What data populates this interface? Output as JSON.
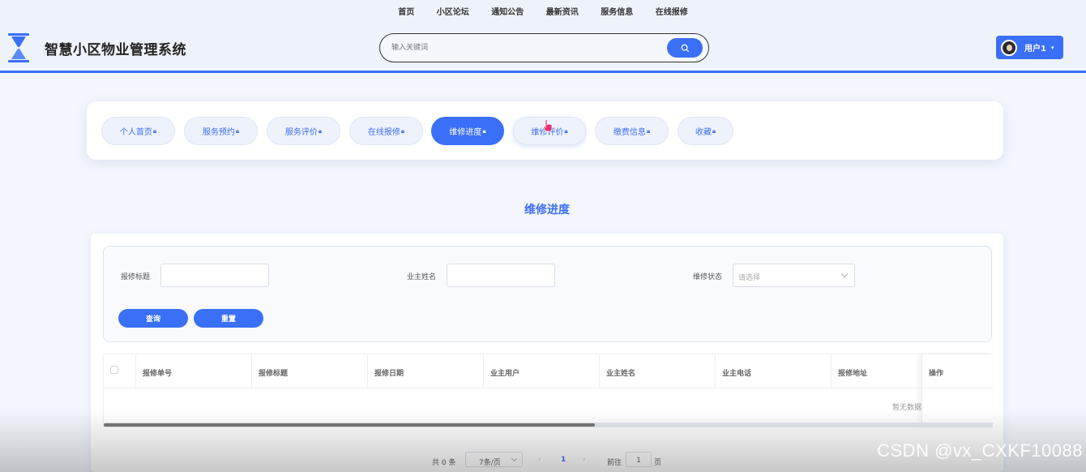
{
  "topnav": [
    "首页",
    "小区论坛",
    "通知公告",
    "最新资讯",
    "服务信息",
    "在线报修"
  ],
  "site_title": "智慧小区物业管理系统",
  "search": {
    "placeholder": "输入关键词",
    "icon": "search-icon"
  },
  "user": {
    "name": "用户1",
    "caret": "▾"
  },
  "tabs": [
    {
      "label": "个人首页",
      "active": false
    },
    {
      "label": "服务预约",
      "active": false
    },
    {
      "label": "服务评价",
      "active": false
    },
    {
      "label": "在线报修",
      "active": false
    },
    {
      "label": "维修进度",
      "active": true
    },
    {
      "label": "维修评价",
      "active": false
    },
    {
      "label": "缴费信息",
      "active": false
    },
    {
      "label": "收藏",
      "active": false
    }
  ],
  "section_title": "维修进度",
  "filters": {
    "title_label": "报修标题",
    "owner_label": "业主姓名",
    "status_label": "维修状态",
    "status_placeholder": "请选择",
    "query_button": "查询",
    "reset_button": "重置"
  },
  "table": {
    "columns": [
      "报修单号",
      "报修标题",
      "报修日期",
      "业主用户",
      "业主姓名",
      "业主电话",
      "报修地址",
      "操作"
    ],
    "empty_text": "暂无数据"
  },
  "pagination": {
    "total": "共 0 条",
    "page_size": "7条/页",
    "prev": "‹",
    "current": "1",
    "next": "›",
    "goto_label": "前往",
    "goto_value": "1",
    "page_label": "页"
  },
  "watermark": "CSDN @vx_CXKF10088",
  "colors": {
    "accent": "#3a6ff7",
    "title": "#3a6ff7"
  }
}
